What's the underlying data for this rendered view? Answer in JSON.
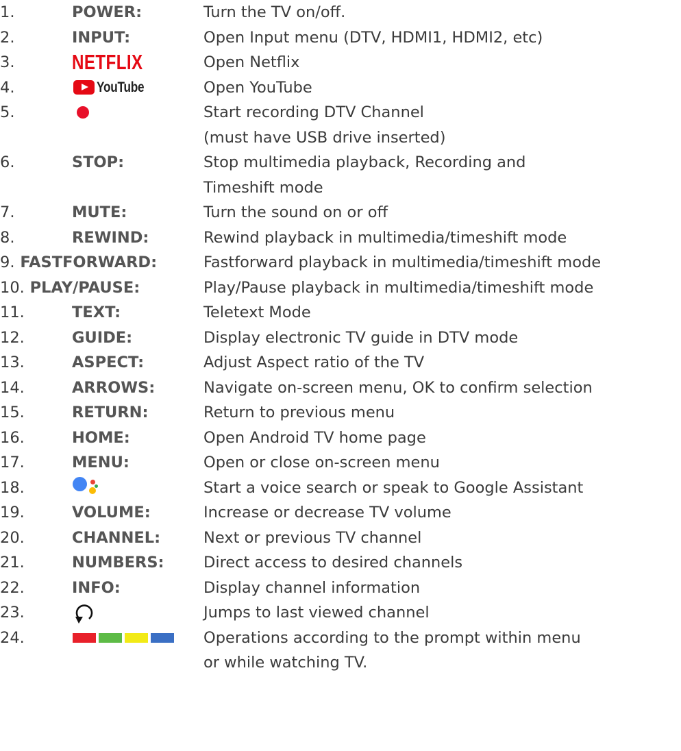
{
  "items": [
    {
      "num": "1.",
      "label": "POWER:",
      "desc": "Turn the TV on/off."
    },
    {
      "num": "2.",
      "label": "INPUT:",
      "desc": "Open Input menu (DTV, HDMI1, HDMI2, etc)"
    },
    {
      "num": "3.",
      "label": "",
      "logo_text": "NETFLIX",
      "icon": "netflix-logo",
      "desc": "Open Netflix"
    },
    {
      "num": "4.",
      "label": "",
      "logo_text": "YouTube",
      "icon": "youtube-logo",
      "desc": "Open YouTube"
    },
    {
      "num": "5.",
      "label": "",
      "icon": "record-dot-icon",
      "desc": "Start recording DTV Channel",
      "desc2": "(must have USB drive inserted)"
    },
    {
      "num": "6.",
      "label": "STOP:",
      "desc": "Stop multimedia playback, Recording and",
      "desc2": "Timeshift mode"
    },
    {
      "num": "7.",
      "label": "MUTE:",
      "desc": "Turn the sound on or off"
    },
    {
      "num": "8.",
      "label": "REWIND:",
      "desc": "Rewind playback in multimedia/timeshift mode"
    },
    {
      "num": "9.",
      "label": "FASTFORWARD:",
      "desc": "Fastforward playback in multimedia/timeshift mode"
    },
    {
      "num": "10.",
      "label": "PLAY/PAUSE:",
      "desc": "Play/Pause playback in multimedia/timeshift mode"
    },
    {
      "num": "11.",
      "label": "TEXT:",
      "desc": "Teletext Mode"
    },
    {
      "num": "12.",
      "label": "GUIDE:",
      "desc": "Display electronic TV guide in DTV mode"
    },
    {
      "num": "13.",
      "label": "ASPECT:",
      "desc": "Adjust Aspect ratio of the TV"
    },
    {
      "num": "14.",
      "label": "ARROWS:",
      "desc": "Navigate on-screen menu, OK to confirm selection"
    },
    {
      "num": "15.",
      "label": "RETURN:",
      "desc": "Return to previous menu"
    },
    {
      "num": "16.",
      "label": "HOME:",
      "desc": "Open Android TV home page"
    },
    {
      "num": "17.",
      "label": "MENU:",
      "desc": "Open or close on-screen menu"
    },
    {
      "num": "18.",
      "label": "",
      "icon": "google-assistant-icon",
      "desc": "Start a voice search or speak to Google Assistant"
    },
    {
      "num": "19.",
      "label": "VOLUME:",
      "desc": "Increase or decrease TV volume"
    },
    {
      "num": "20.",
      "label": "CHANNEL:",
      "desc": "Next or previous TV channel"
    },
    {
      "num": "21.",
      "label": "NUMBERS:",
      "desc": "Direct access to desired channels"
    },
    {
      "num": "22.",
      "label": "INFO:",
      "desc": "Display channel information"
    },
    {
      "num": "23.",
      "label": "",
      "icon": "last-channel-icon",
      "desc": "Jumps to last viewed channel"
    },
    {
      "num": "24.",
      "label": "",
      "icon": "color-buttons-icon",
      "desc": "Operations according to the prompt within menu",
      "desc2": "or while watching TV."
    }
  ],
  "colors": {
    "text": "#3b3b3b",
    "label": "#555555",
    "netflix_red": "#e50914",
    "youtube_red": "#e50914",
    "record_red": "#e8102a",
    "color_buttons": [
      "#e8202a",
      "#5dbb46",
      "#f2ea16",
      "#3a6fc4"
    ],
    "assistant": [
      "#4285f4",
      "#ea4335",
      "#fbbc05",
      "#34a853"
    ]
  }
}
